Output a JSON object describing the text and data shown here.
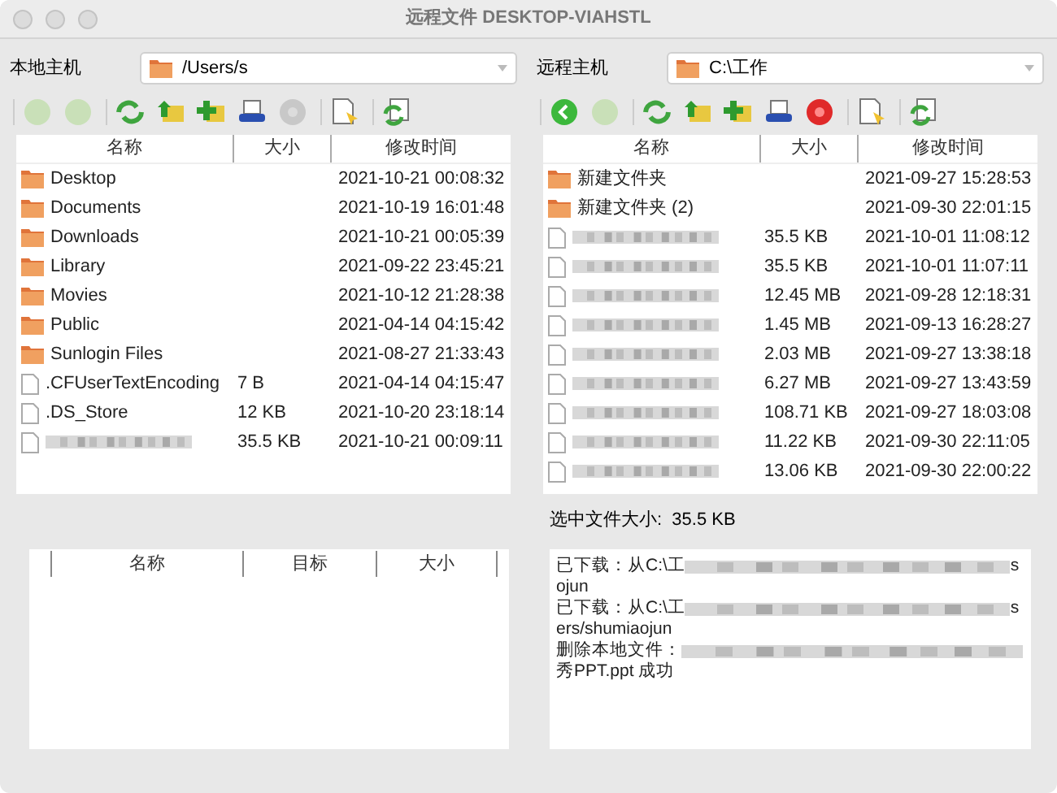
{
  "window": {
    "title": "远程文件 DESKTOP-VIAHSTL"
  },
  "panes": [
    {
      "host_label": "本地主机",
      "path": "/Users/s",
      "toolbar": [
        {
          "kind": "back",
          "enabled": false
        },
        {
          "kind": "forward",
          "enabled": false
        },
        {
          "kind": "refresh"
        },
        {
          "kind": "up"
        },
        {
          "kind": "new-folder"
        },
        {
          "kind": "drive"
        },
        {
          "kind": "stop",
          "enabled": false
        },
        {
          "kind": "properties"
        },
        {
          "kind": "sync"
        }
      ],
      "columns": [
        "名称",
        "大小",
        "修改时间"
      ],
      "rows": [
        {
          "kind": "folder",
          "name": "Desktop",
          "modified": "2021-10-21 00:08:32"
        },
        {
          "kind": "folder",
          "name": "Documents",
          "modified": "2021-10-19 16:01:48"
        },
        {
          "kind": "folder",
          "name": "Downloads",
          "modified": "2021-10-21 00:05:39"
        },
        {
          "kind": "folder",
          "name": "Library",
          "modified": "2021-09-22 23:45:21"
        },
        {
          "kind": "folder",
          "name": "Movies",
          "modified": "2021-10-12 21:28:38"
        },
        {
          "kind": "folder",
          "name": "Public",
          "modified": "2021-04-14 04:15:42"
        },
        {
          "kind": "folder",
          "name": "Sunlogin Files",
          "modified": "2021-08-27 21:33:43"
        },
        {
          "kind": "file",
          "name": ".CFUserTextEncoding",
          "size": "7 B",
          "modified": "2021-04-14 04:15:47"
        },
        {
          "kind": "file",
          "name": ".DS_Store",
          "size": "12 KB",
          "modified": "2021-10-20 23:18:14"
        },
        {
          "kind": "blurred-file",
          "size": "35.5 KB",
          "modified": "2021-10-21 00:09:11"
        }
      ]
    },
    {
      "host_label": "远程主机",
      "path": "C:\\工作",
      "toolbar": [
        {
          "kind": "back",
          "enabled": true
        },
        {
          "kind": "forward",
          "enabled": false
        },
        {
          "kind": "refresh"
        },
        {
          "kind": "up"
        },
        {
          "kind": "new-folder"
        },
        {
          "kind": "drive"
        },
        {
          "kind": "stop",
          "enabled": true
        },
        {
          "kind": "properties"
        },
        {
          "kind": "sync"
        }
      ],
      "columns": [
        "名称",
        "大小",
        "修改时间"
      ],
      "rows": [
        {
          "kind": "folder",
          "name": "新建文件夹",
          "modified": "2021-09-27 15:28:53"
        },
        {
          "kind": "folder",
          "name": "新建文件夹 (2)",
          "modified": "2021-09-30 22:01:15"
        },
        {
          "kind": "blurred-file",
          "size": "35.5 KB",
          "modified": "2021-10-01 11:08:12"
        },
        {
          "kind": "blurred-file",
          "size": "35.5 KB",
          "modified": "2021-10-01 11:07:11"
        },
        {
          "kind": "blurred-file",
          "size": "12.45 MB",
          "modified": "2021-09-28 12:18:31"
        },
        {
          "kind": "blurred-file",
          "size": "1.45 MB",
          "modified": "2021-09-13 16:28:27"
        },
        {
          "kind": "blurred-file",
          "size": "2.03 MB",
          "modified": "2021-09-27 13:38:18"
        },
        {
          "kind": "blurred-file",
          "size": "6.27 MB",
          "modified": "2021-09-27 13:43:59"
        },
        {
          "kind": "blurred-file",
          "size": "108.71 KB",
          "modified": "2021-09-27 18:03:08"
        },
        {
          "kind": "blurred-file",
          "size": "11.22 KB",
          "modified": "2021-09-30 22:11:05"
        },
        {
          "kind": "blurred-file",
          "size": "13.06 KB",
          "modified": "2021-09-30 22:00:22"
        }
      ]
    }
  ],
  "transfer_columns": [
    "名称",
    "目标",
    "大小"
  ],
  "selected_size": "选中文件大小:  35.5 KB",
  "log": [
    {
      "prefix": "已下载：从C:\\工",
      "tail": "s",
      "wrap": "ojun"
    },
    {
      "prefix": "已下载：从C:\\工",
      "tail": "s",
      "wrap": "ers/shumiaojun"
    },
    {
      "prefix": "删除本地文件：",
      "wrap": "秀PPT.ppt 成功"
    }
  ]
}
